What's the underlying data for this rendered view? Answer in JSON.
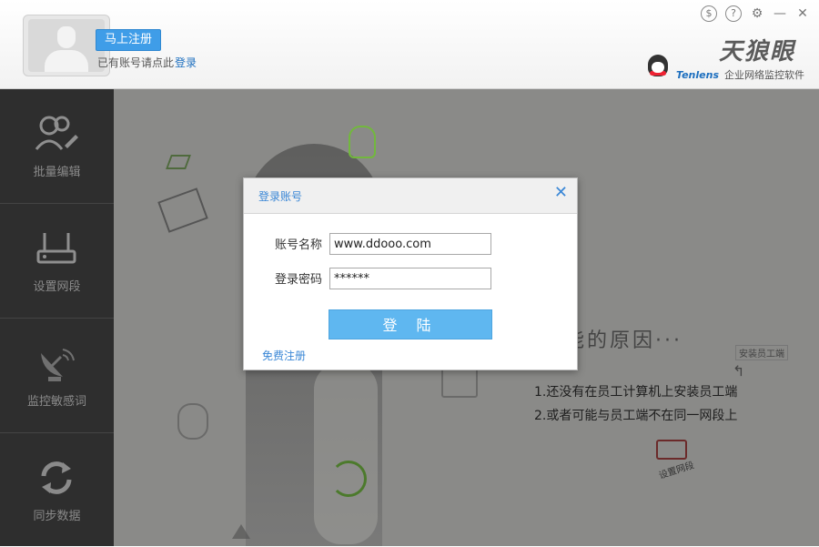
{
  "header": {
    "register_button": "马上注册",
    "login_hint": "已有账号请点此",
    "login_link": "登录",
    "window_controls": [
      {
        "name": "dollar-icon",
        "glyph": "$"
      },
      {
        "name": "help-icon",
        "glyph": "?"
      },
      {
        "name": "settings-gear-icon",
        "glyph": "⚙"
      },
      {
        "name": "minimize-icon",
        "glyph": "—"
      },
      {
        "name": "close-icon",
        "glyph": "✕"
      }
    ],
    "brand_title": "天狼眼",
    "brand_company": "Tenlens",
    "brand_subtitle": "企业网络监控软件"
  },
  "sidebar": {
    "items": [
      {
        "label": "批量编辑",
        "icon": "batch-edit-icon"
      },
      {
        "label": "设置网段",
        "icon": "router-icon"
      },
      {
        "label": "监控敏感词",
        "icon": "satellite-dish-icon"
      },
      {
        "label": "同步数据",
        "icon": "sync-icon"
      }
    ]
  },
  "main": {
    "reason_title": "能的原因···",
    "reasons": [
      "1.还没有在员工计算机上安装员工端",
      "2.或者可能与员工端不在同一网段上"
    ],
    "tag_install": "安装员工端",
    "tag_network": "设置网段"
  },
  "dialog": {
    "title": "登录账号",
    "account_label": "账号名称",
    "account_value": "www.ddooo.com",
    "password_label": "登录密码",
    "password_value": "******",
    "login_button": "登 陆",
    "free_register": "免费注册"
  },
  "colors": {
    "accent_blue": "#3f9de8",
    "login_button": "#5fb7f0",
    "sidebar_bg": "#2e2e2e"
  }
}
